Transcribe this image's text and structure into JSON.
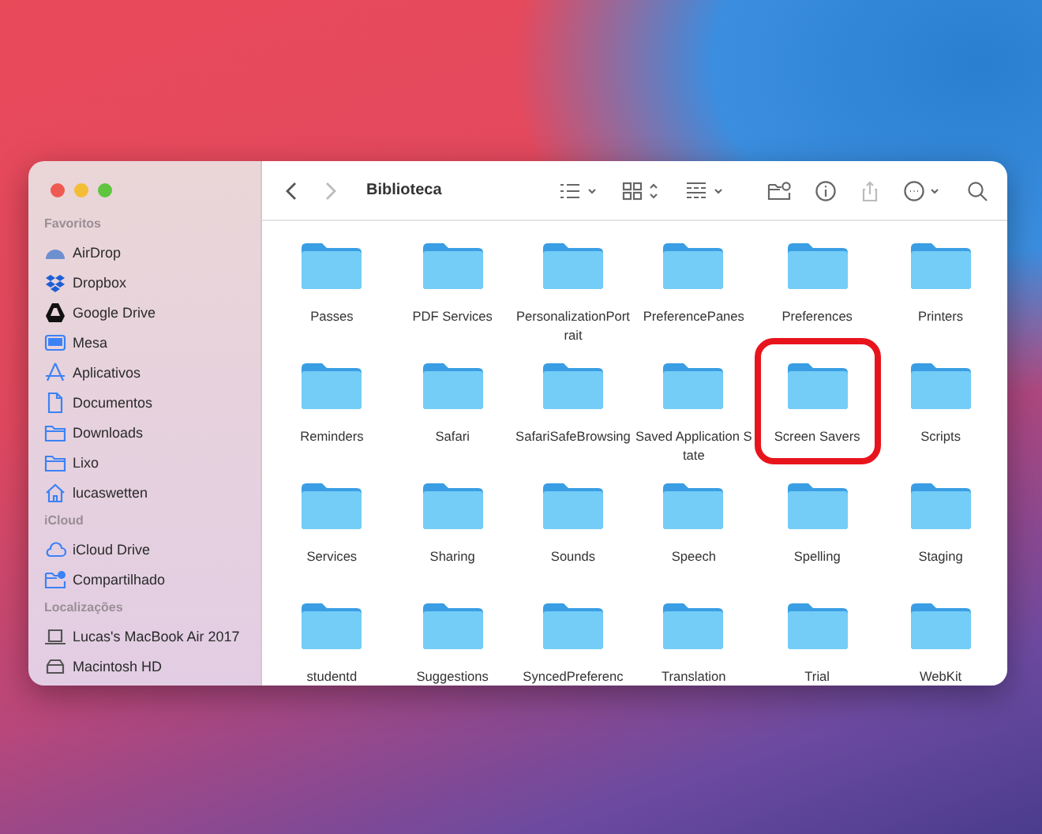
{
  "window": {
    "title": "Biblioteca"
  },
  "sidebar": {
    "sections": [
      {
        "heading": "Favoritos",
        "items": [
          {
            "label": "AirDrop",
            "kind": "airdrop"
          },
          {
            "label": "Dropbox",
            "kind": "dropbox"
          },
          {
            "label": "Google Drive",
            "kind": "drive"
          },
          {
            "label": "Mesa",
            "kind": "desktop"
          },
          {
            "label": "Aplicativos",
            "kind": "apps"
          },
          {
            "label": "Documentos",
            "kind": "document"
          },
          {
            "label": "Downloads",
            "kind": "folder"
          },
          {
            "label": "Lixo",
            "kind": "folder"
          },
          {
            "label": "lucaswetten",
            "kind": "home"
          }
        ]
      },
      {
        "heading": "iCloud",
        "items": [
          {
            "label": "iCloud Drive",
            "kind": "cloud"
          },
          {
            "label": "Compartilhado",
            "kind": "shared"
          }
        ]
      },
      {
        "heading": "Localizações",
        "items": [
          {
            "label": "Lucas's MacBook Air 2017",
            "kind": "laptop"
          },
          {
            "label": "Macintosh HD",
            "kind": "disk"
          }
        ]
      }
    ]
  },
  "folders": [
    {
      "name": "Passes",
      "highlighted": false
    },
    {
      "name": "PDF Services",
      "highlighted": false
    },
    {
      "name": "PersonalizationPortrait",
      "highlighted": false
    },
    {
      "name": "PreferencePanes",
      "highlighted": false
    },
    {
      "name": "Preferences",
      "highlighted": false
    },
    {
      "name": "Printers",
      "highlighted": false
    },
    {
      "name": "Reminders",
      "highlighted": false
    },
    {
      "name": "Safari",
      "highlighted": false
    },
    {
      "name": "SafariSafeBrowsing",
      "highlighted": false
    },
    {
      "name": "Saved Application State",
      "highlighted": false
    },
    {
      "name": "Screen Savers",
      "highlighted": true
    },
    {
      "name": "Scripts",
      "highlighted": false
    },
    {
      "name": "Services",
      "highlighted": false
    },
    {
      "name": "Sharing",
      "highlighted": false
    },
    {
      "name": "Sounds",
      "highlighted": false
    },
    {
      "name": "Speech",
      "highlighted": false
    },
    {
      "name": "Spelling",
      "highlighted": false
    },
    {
      "name": "Staging",
      "highlighted": false
    },
    {
      "name": "studentd",
      "highlighted": false
    },
    {
      "name": "Suggestions",
      "highlighted": false
    },
    {
      "name": "SyncedPreferenc",
      "highlighted": false
    },
    {
      "name": "Translation",
      "highlighted": false
    },
    {
      "name": "Trial",
      "highlighted": false
    },
    {
      "name": "WebKit",
      "highlighted": false
    }
  ]
}
